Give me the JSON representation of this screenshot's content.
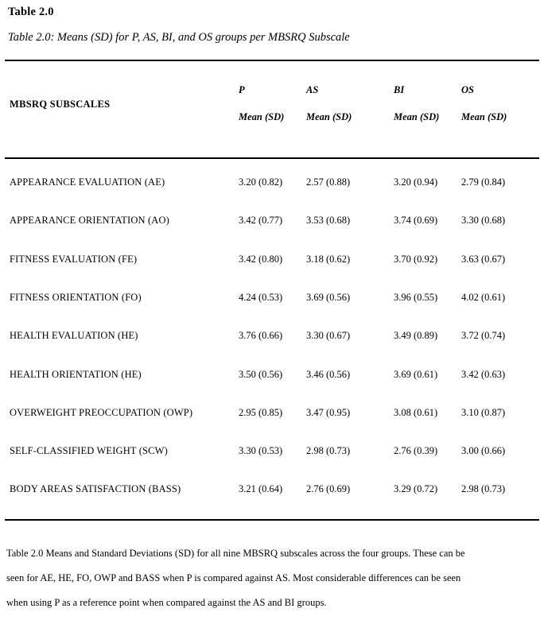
{
  "title": "Table 2.0",
  "caption": "Table 2.0: Means (SD) for P, AS, BI, and OS groups per MBSRQ Subscale",
  "chart_data": {
    "type": "table",
    "title": "Table 2.0: Means (SD) for P, AS, BI, and OS groups per MBSRQ Subscale",
    "stub_header": "MBSRQ SUBSCALES",
    "group_headers": [
      "P",
      "AS",
      "BI",
      "OS"
    ],
    "subheader": "Mean (SD)",
    "columns": [
      "MBSRQ SUBSCALES",
      "P Mean (SD)",
      "AS Mean (SD)",
      "BI Mean (SD)",
      "OS Mean (SD)"
    ],
    "categories": [
      "APPEARANCE EVALUATION (AE)",
      "APPEARANCE ORIENTATION (AO)",
      "FITNESS EVALUATION (FE)",
      "FITNESS ORIENTATION (FO)",
      "HEALTH EVALUATION (HE)",
      "HEALTH ORIENTATION (HE)",
      "OVERWEIGHT PREOCCUPATION (OWP)",
      "SELF-CLASSIFIED WEIGHT (SCW)",
      "BODY AREAS SATISFACTION (BASS)"
    ],
    "series": [
      {
        "name": "P",
        "means": [
          3.2,
          3.42,
          3.42,
          4.24,
          3.76,
          3.5,
          2.95,
          3.3,
          3.21
        ],
        "sds": [
          0.82,
          0.77,
          0.8,
          0.53,
          0.66,
          0.56,
          0.85,
          0.53,
          0.64
        ]
      },
      {
        "name": "AS",
        "means": [
          2.57,
          3.53,
          3.18,
          3.69,
          3.3,
          3.46,
          3.47,
          2.98,
          2.76
        ],
        "sds": [
          0.88,
          0.68,
          0.62,
          0.56,
          0.67,
          0.56,
          0.95,
          0.73,
          0.69
        ]
      },
      {
        "name": "BI",
        "means": [
          3.2,
          3.74,
          3.7,
          3.96,
          3.49,
          3.69,
          3.08,
          2.76,
          3.29
        ],
        "sds": [
          0.94,
          0.69,
          0.92,
          0.55,
          0.89,
          0.61,
          0.61,
          0.39,
          0.72
        ]
      },
      {
        "name": "OS",
        "means": [
          2.79,
          3.3,
          3.63,
          4.02,
          3.72,
          3.42,
          3.1,
          3.0,
          2.98
        ],
        "sds": [
          0.84,
          0.68,
          0.67,
          0.61,
          0.74,
          0.63,
          0.87,
          0.66,
          0.73
        ]
      }
    ],
    "rows": [
      {
        "label": "APPEARANCE EVALUATION (AE)",
        "cells": [
          "3.20 (0.82)",
          "2.57 (0.88)",
          "3.20 (0.94)",
          "2.79 (0.84)"
        ]
      },
      {
        "label": "APPEARANCE ORIENTATION (AO)",
        "cells": [
          "3.42 (0.77)",
          "3.53 (0.68)",
          "3.74 (0.69)",
          "3.30 (0.68)"
        ]
      },
      {
        "label": "FITNESS EVALUATION (FE)",
        "cells": [
          "3.42 (0.80)",
          "3.18 (0.62)",
          "3.70 (0.92)",
          "3.63 (0.67)"
        ]
      },
      {
        "label": "FITNESS ORIENTATION (FO)",
        "cells": [
          "4.24 (0.53)",
          "3.69 (0.56)",
          "3.96 (0.55)",
          "4.02 (0.61)"
        ]
      },
      {
        "label": "HEALTH EVALUATION (HE)",
        "cells": [
          "3.76 (0.66)",
          "3.30 (0.67)",
          "3.49 (0.89)",
          "3.72 (0.74)"
        ]
      },
      {
        "label": "HEALTH ORIENTATION (HE)",
        "cells": [
          "3.50 (0.56)",
          "3.46 (0.56)",
          "3.69 (0.61)",
          "3.42 (0.63)"
        ]
      },
      {
        "label": "OVERWEIGHT PREOCCUPATION (OWP)",
        "cells": [
          "2.95 (0.85)",
          "3.47 (0.95)",
          "3.08 (0.61)",
          "3.10 (0.87)"
        ]
      },
      {
        "label": "SELF-CLASSIFIED WEIGHT (SCW)",
        "cells": [
          "3.30 (0.53)",
          "2.98 (0.73)",
          "2.76 (0.39)",
          "3.00 (0.66)"
        ]
      },
      {
        "label": "BODY AREAS SATISFACTION (BASS)",
        "cells": [
          "3.21 (0.64)",
          "2.76 (0.69)",
          "3.29 (0.72)",
          "2.98 (0.73)"
        ]
      }
    ]
  },
  "footnote": {
    "lines": [
      "Table 2.0 Means and Standard Deviations (SD) for all nine MBSRQ subscales across the four groups. These can be",
      "seen for AE, HE, FO, OWP and BASS when P is compared against AS. Most considerable differences can be seen",
      "when using P as a reference point when compared against the AS and BI groups."
    ]
  }
}
